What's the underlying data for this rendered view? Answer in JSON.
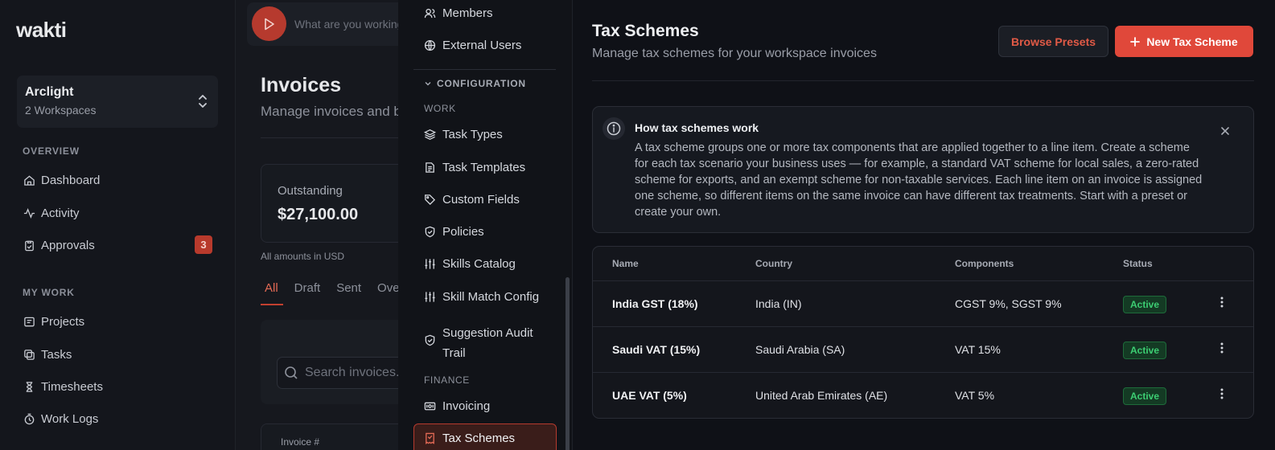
{
  "app": {
    "logo": "wakti",
    "workspace": {
      "name": "Arclight",
      "count": "2 Workspaces"
    },
    "sections": {
      "overview": "OVERVIEW",
      "mywork": "MY WORK"
    },
    "overview_items": [
      {
        "label": "Dashboard",
        "icon": "home-icon"
      },
      {
        "label": "Activity",
        "icon": "activity-icon"
      },
      {
        "label": "Approvals",
        "icon": "clipboard-check-icon",
        "badge": "3"
      }
    ],
    "mywork_items": [
      {
        "label": "Projects",
        "icon": "folder-icon"
      },
      {
        "label": "Tasks",
        "icon": "tasks-icon"
      },
      {
        "label": "Timesheets",
        "icon": "hourglass-icon"
      },
      {
        "label": "Work Logs",
        "icon": "timer-icon"
      }
    ]
  },
  "invoices": {
    "timer_placeholder": "What are you working on?",
    "title": "Invoices",
    "subtitle": "Manage invoices and billing",
    "outstanding_label": "Outstanding",
    "outstanding_value": "$27,100.00",
    "amount_note": "All amounts in USD",
    "tabs": [
      "All",
      "Draft",
      "Sent",
      "Overdue"
    ],
    "search_placeholder": "Search invoices...",
    "table_header_first": "Invoice #"
  },
  "settings_nav": {
    "top_items": [
      {
        "label": "Members",
        "icon": "users-icon"
      },
      {
        "label": "External Users",
        "icon": "globe-icon"
      }
    ],
    "group": "CONFIGURATION",
    "work_label": "WORK",
    "work_items": [
      {
        "label": "Task Types",
        "icon": "layers-icon"
      },
      {
        "label": "Task Templates",
        "icon": "file-template-icon"
      },
      {
        "label": "Custom Fields",
        "icon": "tag-icon"
      },
      {
        "label": "Policies",
        "icon": "shield-check-icon"
      },
      {
        "label": "Skills Catalog",
        "icon": "sliders-icon"
      },
      {
        "label": "Skill Match Config",
        "icon": "sliders-icon"
      },
      {
        "label": "Suggestion Audit",
        "label2": "Trail",
        "icon": "shield-check-icon"
      }
    ],
    "finance_label": "FINANCE",
    "finance_items": [
      {
        "label": "Invoicing",
        "icon": "banknote-icon"
      },
      {
        "label": "Tax Schemes",
        "icon": "receipt-icon"
      }
    ]
  },
  "tax": {
    "title": "Tax Schemes",
    "subtitle": "Manage tax schemes for your workspace invoices",
    "browse_presets": "Browse Presets",
    "new_scheme": "New Tax Scheme",
    "info_title": "How tax schemes work",
    "info_body": "A tax scheme groups one or more tax components that are applied together to a line item. Create a scheme for each tax scenario your business uses — for example, a standard VAT scheme for local sales, a zero-rated scheme for exports, and an exempt scheme for non-taxable services. Each line item on an invoice is assigned one scheme, so different items on the same invoice can have different tax treatments. Start with a preset or create your own.",
    "columns": [
      "Name",
      "Country",
      "Components",
      "Status"
    ],
    "rows": [
      {
        "name": "India GST (18%)",
        "country": "India (IN)",
        "components": "CGST 9%, SGST 9%",
        "status": "Active"
      },
      {
        "name": "Saudi VAT (15%)",
        "country": "Saudi Arabia (SA)",
        "components": "VAT 15%",
        "status": "Active"
      },
      {
        "name": "UAE VAT (5%)",
        "country": "United Arab Emirates (AE)",
        "components": "VAT 5%",
        "status": "Active"
      }
    ],
    "colors": {
      "accent": "#e0483a",
      "active_status": "#3ccd72"
    }
  }
}
